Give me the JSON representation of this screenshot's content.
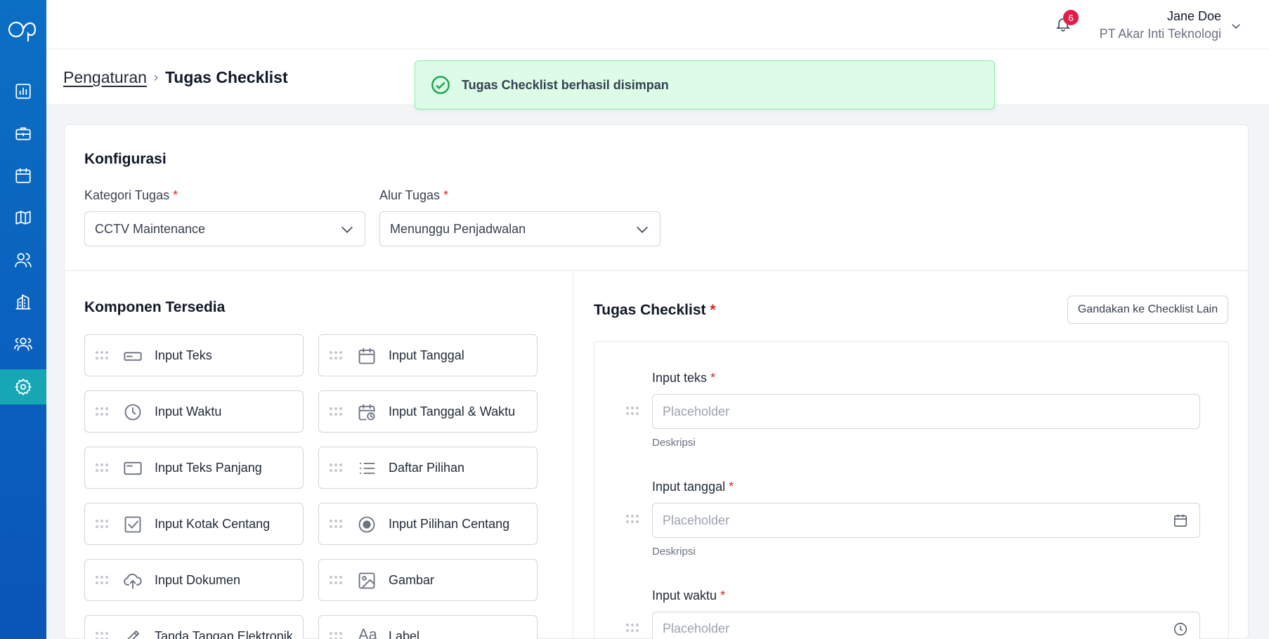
{
  "topbar": {
    "notification_count": "6",
    "user_name": "Jane Doe",
    "user_company": "PT Akar Inti Teknologi"
  },
  "breadcrumb": {
    "parent": "Pengaturan",
    "separator": "›",
    "current": "Tugas Checklist"
  },
  "toast": {
    "message": "Tugas Checklist berhasil disimpan",
    "color": "#dcfce7"
  },
  "sidebar": {
    "items": [
      {
        "icon": "chart-icon"
      },
      {
        "icon": "briefcase-icon"
      },
      {
        "icon": "calendar-icon"
      },
      {
        "icon": "map-icon"
      },
      {
        "icon": "users-icon"
      },
      {
        "icon": "building-icon"
      },
      {
        "icon": "team-icon"
      },
      {
        "icon": "gear-icon",
        "active": true
      }
    ],
    "accent": "#17a6b4"
  },
  "config": {
    "title": "Konfigurasi",
    "category_label": "Kategori Tugas",
    "category_value": "CCTV Maintenance",
    "flow_label": "Alur Tugas",
    "flow_value": "Menunggu Penjadwalan",
    "required_mark": "*"
  },
  "components": {
    "title": "Komponen Tersedia",
    "items": [
      "Input Teks",
      "Input Tanggal",
      "Input Waktu",
      "Input Tanggal & Waktu",
      "Input Teks Panjang",
      "Daftar Pilihan",
      "Input Kotak Centang",
      "Input Pilihan Centang",
      "Input Dokumen",
      "Gambar",
      "Tanda Tangan Elektronik",
      "Label"
    ]
  },
  "checklist": {
    "title": "Tugas Checklist",
    "required_mark": "*",
    "duplicate_button": "Gandakan ke Checklist Lain",
    "fields": [
      {
        "label": "Input teks",
        "placeholder": "Placeholder",
        "description": "Deskripsi"
      },
      {
        "label": "Input tanggal",
        "placeholder": "Placeholder",
        "description": "Deskripsi"
      },
      {
        "label": "Input waktu",
        "placeholder": "Placeholder"
      }
    ]
  }
}
